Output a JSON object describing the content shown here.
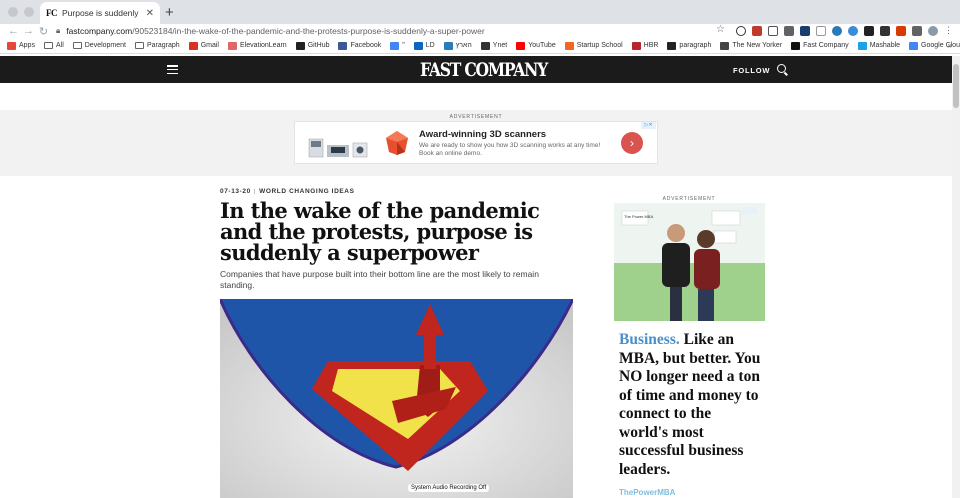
{
  "browser": {
    "tab_title": "Purpose is suddenly a superpo",
    "tab_favicon": "FC",
    "url_host": "fastcompany.com",
    "url_path": "/90523184/in-the-wake-of-the-pandemic-and-the-protests-purpose-is-suddenly-a-super-power",
    "bookmarks": [
      {
        "label": "Apps",
        "icon": "apps-icon",
        "color": "#e8453c"
      },
      {
        "label": "All",
        "icon": "folder-icon"
      },
      {
        "label": "Development",
        "icon": "folder-icon"
      },
      {
        "label": "Paragraph",
        "icon": "folder-icon"
      },
      {
        "label": "Gmail",
        "icon": "gmail-icon",
        "color": "#d93025"
      },
      {
        "label": "ElevationLearn",
        "icon": "elevation-icon",
        "color": "#e06666"
      },
      {
        "label": "GitHub",
        "icon": "github-icon",
        "color": "#222222"
      },
      {
        "label": "Facebook",
        "icon": "facebook-icon",
        "color": "#3b5998"
      },
      {
        "label": "\"",
        "icon": "translate-icon",
        "color": "#4285f4"
      },
      {
        "label": "LD",
        "icon": "linkedin-icon",
        "color": "#0a66c2"
      },
      {
        "label": "הארץ",
        "icon": "haaretz-icon",
        "color": "#2b7bb9"
      },
      {
        "label": "Ynet",
        "icon": "ynet-icon",
        "color": "#333333"
      },
      {
        "label": "YouTube",
        "icon": "youtube-icon",
        "color": "#ff0000"
      },
      {
        "label": "Startup School",
        "icon": "yc-icon",
        "color": "#f26522"
      },
      {
        "label": "HBR",
        "icon": "hbr-icon",
        "color": "#b8262c"
      },
      {
        "label": "paragraph",
        "icon": "paragraph-icon",
        "color": "#222222"
      },
      {
        "label": "The New Yorker",
        "icon": "newyorker-icon",
        "color": "#444444"
      },
      {
        "label": "Fast Company",
        "icon": "fastcompany-icon",
        "color": "#111111"
      },
      {
        "label": "Mashable",
        "icon": "mashable-icon",
        "color": "#1aa3e8"
      },
      {
        "label": "Google Cloud Plat...",
        "icon": "gcp-icon",
        "color": "#4285f4"
      }
    ],
    "more_bookmarks": "»"
  },
  "site": {
    "logo": "FAST COMPANY",
    "follow_label": "FOLLOW"
  },
  "top_ad": {
    "label": "ADVERTISEMENT",
    "title": "Award-winning 3D scanners",
    "description": "We are ready to show you how 3D scanning works at any time! Book an online demo."
  },
  "article": {
    "date": "07-13-20",
    "section": "WORLD CHANGING IDEAS",
    "headline": "In the wake of the pandemic and the protests, purpose is suddenly a superpower",
    "dek": "Companies that have purpose built into their bottom line are the most likely to remain standing.",
    "recording_notice": "System Audio Recording Off"
  },
  "side_ad": {
    "label": "ADVERTISEMENT",
    "highlight": "Business.",
    "body": " Like an MBA, but better. You NO longer need a ton of time and money to connect to the world's most successful business leaders.",
    "brand": "ThePowerMBA",
    "photo_sign": "The Power MBA"
  },
  "colors": {
    "header_bg": "#1b1b1b",
    "ad_accent": "#d9534f",
    "brand_blue": "#4a90c8"
  }
}
